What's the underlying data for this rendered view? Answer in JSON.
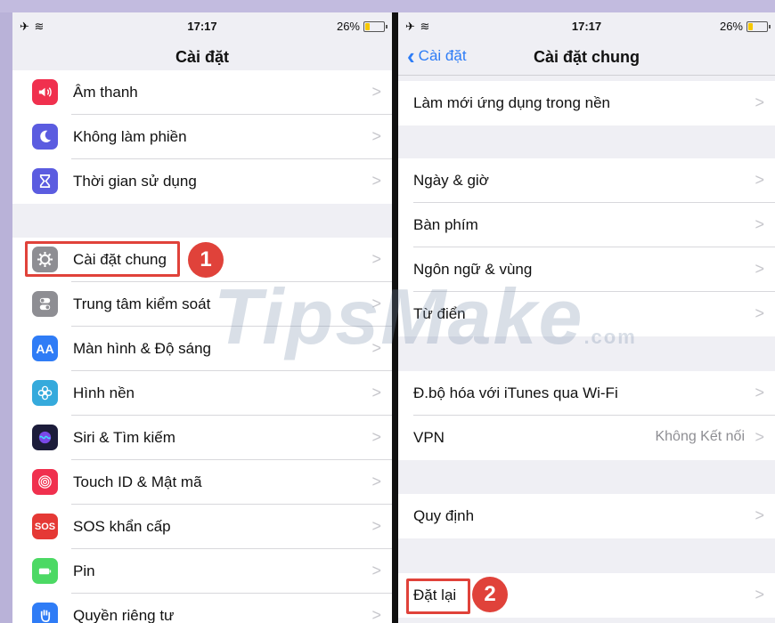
{
  "status": {
    "time": "17:17",
    "battery": "26%",
    "battery_level": 0.26,
    "signal_icons": "✈ ≋"
  },
  "left": {
    "title": "Cài đặt",
    "rows": [
      {
        "label": "Âm thanh",
        "icon": "sound-icon",
        "color": "#f0304e"
      },
      {
        "label": "Không làm phiền",
        "icon": "moon-icon",
        "color": "#5b5ce0"
      },
      {
        "label": "Thời gian sử dụng",
        "icon": "hourglass-icon",
        "color": "#5b5ce0"
      },
      {
        "label": "Cài đặt chung",
        "icon": "gear-icon",
        "color": "#8e8e93"
      },
      {
        "label": "Trung tâm kiểm soát",
        "icon": "toggles-icon",
        "color": "#8e8e93"
      },
      {
        "label": "Màn hình & Độ sáng",
        "icon": "text-size-icon",
        "color": "#2f7cf6",
        "glyph": "AA"
      },
      {
        "label": "Hình nền",
        "icon": "flower-icon",
        "color": "#35aadc"
      },
      {
        "label": "Siri & Tìm kiếm",
        "icon": "siri-icon",
        "color": "#1c1c3a"
      },
      {
        "label": "Touch ID & Mật mã",
        "icon": "fingerprint-icon",
        "color": "#f0304e"
      },
      {
        "label": "SOS khẩn cấp",
        "icon": "sos-icon",
        "color": "#e53935",
        "glyph": "SOS"
      },
      {
        "label": "Pin",
        "icon": "battery-icon",
        "color": "#4cd964"
      },
      {
        "label": "Quyền riêng tư",
        "icon": "hand-icon",
        "color": "#2f7cf6"
      }
    ]
  },
  "right": {
    "title": "Cài đặt chung",
    "back_label": "Cài đặt",
    "rows": [
      {
        "label": "Làm mới ứng dụng trong nền"
      },
      {
        "label": "Ngày & giờ"
      },
      {
        "label": "Bàn phím"
      },
      {
        "label": "Ngôn ngữ & vùng"
      },
      {
        "label": "Từ điển"
      },
      {
        "label": "Đ.bộ hóa với iTunes qua Wi-Fi"
      },
      {
        "label": "VPN",
        "value": "Không Kết nối"
      },
      {
        "label": "Quy định"
      },
      {
        "label": "Đặt lại"
      }
    ]
  },
  "callouts": {
    "first": "1",
    "second": "2"
  },
  "watermark": {
    "main": "TipsMake",
    "suffix": ".com"
  },
  "colors": {
    "accent": "#2d7cf6",
    "callout": "#e0423a",
    "group_bg": "#efeff4"
  }
}
